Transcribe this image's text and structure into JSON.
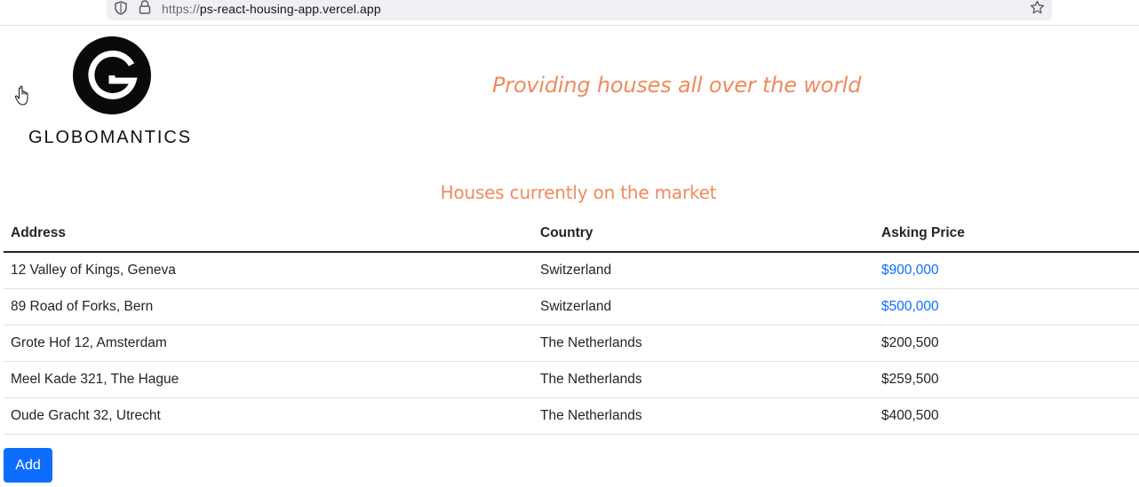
{
  "browser": {
    "url_scheme": "https://",
    "url_host": "ps-react-housing-app.vercel.app",
    "icons": [
      "shield-icon",
      "lock-icon",
      "star-icon"
    ]
  },
  "header": {
    "logo_text": "GLOBOMANTICS",
    "tagline": "Providing houses all over the world",
    "accent_color": "#f08a5d"
  },
  "main": {
    "subtitle": "Houses currently on the market",
    "columns": [
      "Address",
      "Country",
      "Asking Price"
    ],
    "rows": [
      {
        "address": "12 Valley of Kings, Geneva",
        "country": "Switzerland",
        "price": "$900,000",
        "price_highlight": true
      },
      {
        "address": "89 Road of Forks, Bern",
        "country": "Switzerland",
        "price": "$500,000",
        "price_highlight": true
      },
      {
        "address": "Grote Hof 12, Amsterdam",
        "country": "The Netherlands",
        "price": "$200,500",
        "price_highlight": false
      },
      {
        "address": "Meel Kade 321, The Hague",
        "country": "The Netherlands",
        "price": "$259,500",
        "price_highlight": false
      },
      {
        "address": "Oude Gracht 32, Utrecht",
        "country": "The Netherlands",
        "price": "$400,500",
        "price_highlight": false
      }
    ],
    "add_label": "Add",
    "button_color": "#0d6efd"
  }
}
